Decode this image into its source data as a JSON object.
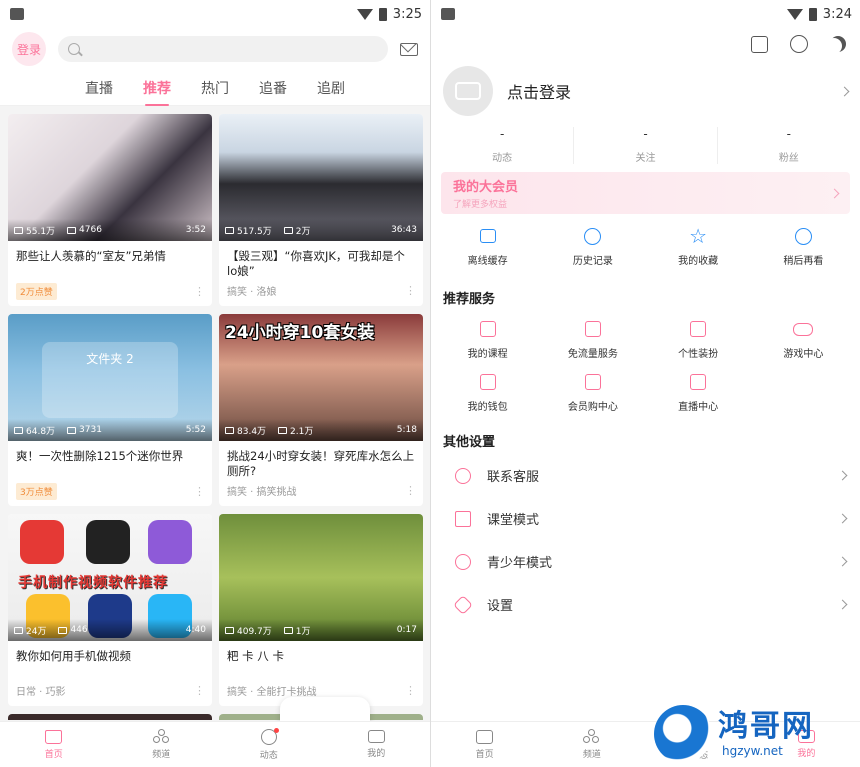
{
  "left": {
    "status_time": "3:25",
    "login_label": "登录",
    "search_placeholder": "",
    "tabs": [
      "直播",
      "推荐",
      "热门",
      "追番",
      "追剧"
    ],
    "active_tab": "推荐",
    "cards": [
      {
        "views": "55.1万",
        "danmaku": "4766",
        "duration": "3:52",
        "title": "那些让人羡慕的“室友”兄弟情",
        "badge": "2万点赞",
        "tag": ""
      },
      {
        "views": "517.5万",
        "danmaku": "2万",
        "duration": "36:43",
        "title": "【毁三观】“你喜欢JK，可我却是个lo娘”",
        "badge": "",
        "tag": "搞笑 · 洛娘"
      },
      {
        "views": "64.8万",
        "danmaku": "3731",
        "duration": "5:52",
        "title": "爽！一次性删除1215个迷你世界",
        "badge": "3万点赞",
        "tag": "",
        "overlay": "文件夹 2"
      },
      {
        "views": "83.4万",
        "danmaku": "2.1万",
        "duration": "5:18",
        "title": "挑战24小时穿女装！穿死库水怎么上厕所?",
        "badge": "",
        "tag": "搞笑 · 搞笑挑战",
        "overlay": "24小时穿10套女装"
      },
      {
        "views": "24万",
        "danmaku": "446",
        "duration": "4:40",
        "title": "教你如何用手机做视频",
        "badge": "",
        "tag": "日常 · 巧影",
        "overlay": "手机制作视频软件推荐"
      },
      {
        "views": "409.7万",
        "danmaku": "1万",
        "duration": "0:17",
        "title": "粑 卡 八 卡",
        "badge": "",
        "tag": "搞笑 · 全能打卡挑战"
      }
    ],
    "nav": [
      "首页",
      "频道",
      "动态",
      "我的"
    ]
  },
  "right": {
    "status_time": "3:24",
    "login_prompt": "点击登录",
    "stats": [
      {
        "value": "-",
        "label": "动态"
      },
      {
        "value": "-",
        "label": "关注"
      },
      {
        "value": "-",
        "label": "粉丝"
      }
    ],
    "vip_title": "我的大会员",
    "vip_sub": "了解更多权益",
    "quick": [
      "离线缓存",
      "历史记录",
      "我的收藏",
      "稍后再看"
    ],
    "services_title": "推荐服务",
    "services": [
      "我的课程",
      "免流量服务",
      "个性装扮",
      "游戏中心",
      "我的钱包",
      "会员购中心",
      "直播中心"
    ],
    "other_title": "其他设置",
    "settings": [
      "联系客服",
      "课堂模式",
      "青少年模式",
      "设置"
    ],
    "nav": [
      "首页",
      "频道",
      "动态",
      "我的"
    ]
  },
  "watermark": {
    "title": "鸿哥网",
    "url": "hgzyw.net"
  },
  "colors": {
    "accent": "#fb7299",
    "blue": "#2a8ef5"
  }
}
